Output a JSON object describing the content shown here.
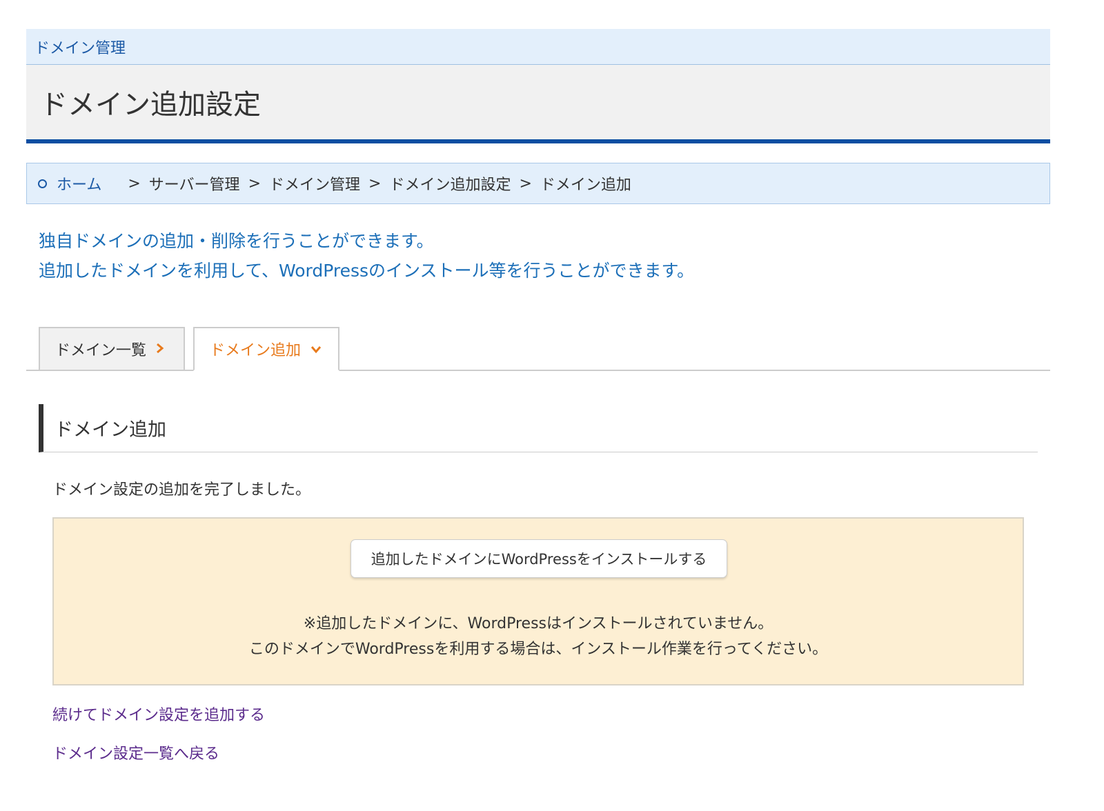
{
  "section": {
    "title": "ドメイン管理"
  },
  "page": {
    "title": "ドメイン追加設定"
  },
  "breadcrumb": {
    "home": "ホーム",
    "items": [
      "サーバー管理",
      "ドメイン管理",
      "ドメイン追加設定",
      "ドメイン追加"
    ],
    "separator": ">"
  },
  "intro": {
    "line1": "独自ドメインの追加・削除を行うことができます。",
    "line2": "追加したドメインを利用して、WordPressのインストール等を行うことができます。"
  },
  "tabs": {
    "list": {
      "label": "ドメイン一覧",
      "icon": "chevron-right-icon"
    },
    "add": {
      "label": "ドメイン追加",
      "icon": "chevron-down-icon"
    }
  },
  "content": {
    "heading": "ドメイン追加",
    "done_message": "ドメイン設定の追加を完了しました。",
    "install_button": "追加したドメインにWordPressをインストールする",
    "note_line1": "※追加したドメインに、WordPressはインストールされていません。",
    "note_line2": "このドメインでWordPressを利用する場合は、インストール作業を行ってください。"
  },
  "links": {
    "continue": "続けてドメイン設定を追加する",
    "back": "ドメイン設定一覧へ戻る"
  },
  "colors": {
    "accent_blue": "#0b4ea2",
    "link_blue": "#1c6fb8",
    "tab_active": "#e87a1c",
    "notice_bg": "#fdefd3",
    "visited_link": "#5b2b8c"
  }
}
